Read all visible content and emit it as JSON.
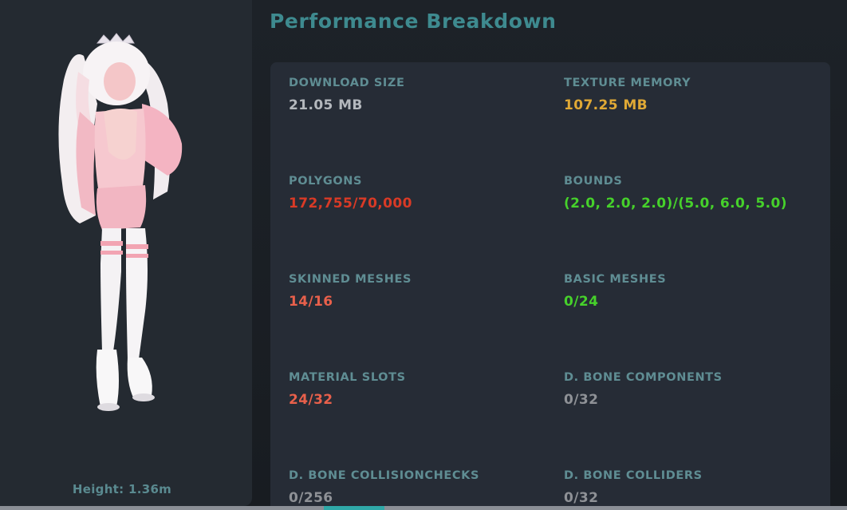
{
  "title": "Performance Breakdown",
  "preview": {
    "height_label": "Height: 1.36m"
  },
  "stats": [
    {
      "label": "DOWNLOAD SIZE",
      "value": "21.05 MB",
      "color": "#b4b8bd"
    },
    {
      "label": "TEXTURE MEMORY",
      "value": "107.25 MB",
      "color": "#e0a935"
    },
    {
      "label": "POLYGONS",
      "value": "172,755/70,000",
      "color": "#d93a26"
    },
    {
      "label": "BOUNDS",
      "value": "(2.0, 2.0, 2.0)/(5.0, 6.0, 5.0)",
      "color": "#46d12b"
    },
    {
      "label": "SKINNED MESHES",
      "value": "14/16",
      "color": "#e8604b"
    },
    {
      "label": "BASIC MESHES",
      "value": "0/24",
      "color": "#46d12b"
    },
    {
      "label": "MATERIAL SLOTS",
      "value": "24/32",
      "color": "#e8604b"
    },
    {
      "label": "D. BONE COMPONENTS",
      "value": "0/32",
      "color": "#8e9196"
    },
    {
      "label": "D. BONE COLLISIONCHECKS",
      "value": "0/256",
      "color": "#8e9196"
    },
    {
      "label": "D. BONE COLLIDERS",
      "value": "0/32",
      "color": "#8e9196"
    }
  ]
}
